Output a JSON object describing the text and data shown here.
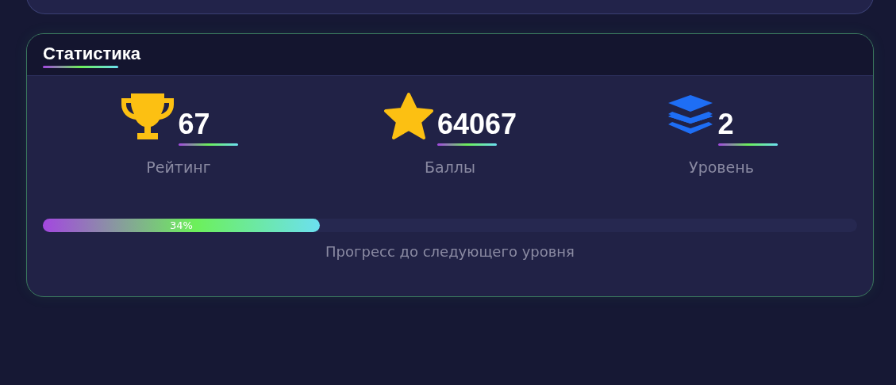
{
  "stats_card": {
    "title": "Статистика",
    "stats": [
      {
        "kind": "trophy",
        "value": "67",
        "label": "Рейтинг"
      },
      {
        "kind": "star",
        "value": "64067",
        "label": "Баллы"
      },
      {
        "kind": "layers",
        "value": "2",
        "label": "Уровень"
      }
    ],
    "progress": {
      "level": 0.34,
      "reading": "34%",
      "caption": "Прогресс до следующего уровня"
    }
  }
}
